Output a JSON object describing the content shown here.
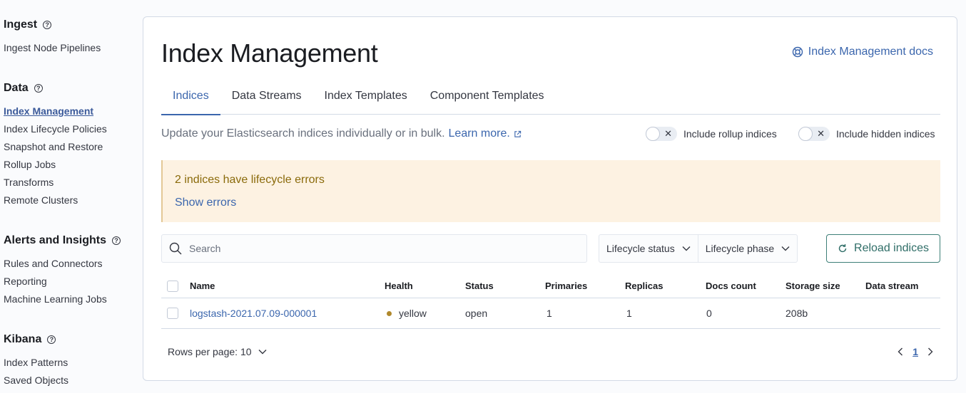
{
  "sidebar": {
    "groups": [
      {
        "title": "Ingest",
        "items": [
          "Ingest Node Pipelines"
        ]
      },
      {
        "title": "Data",
        "items": [
          "Index Management",
          "Index Lifecycle Policies",
          "Snapshot and Restore",
          "Rollup Jobs",
          "Transforms",
          "Remote Clusters"
        ]
      },
      {
        "title": "Alerts and Insights",
        "items": [
          "Rules and Connectors",
          "Reporting",
          "Machine Learning Jobs"
        ]
      },
      {
        "title": "Kibana",
        "items": [
          "Index Patterns",
          "Saved Objects"
        ]
      }
    ],
    "active_item": "Index Management"
  },
  "header": {
    "title": "Index Management",
    "docs_link": "Index Management docs"
  },
  "tabs": [
    {
      "label": "Indices",
      "active": true
    },
    {
      "label": "Data Streams",
      "active": false
    },
    {
      "label": "Index Templates",
      "active": false
    },
    {
      "label": "Component Templates",
      "active": false
    }
  ],
  "description": {
    "text": "Update your Elasticsearch indices individually or in bulk.",
    "link": "Learn more."
  },
  "toggles": {
    "rollup": {
      "label": "Include rollup indices",
      "on": false
    },
    "hidden": {
      "label": "Include hidden indices",
      "on": false
    }
  },
  "callout": {
    "title": "2 indices have lifecycle errors",
    "link": "Show errors"
  },
  "search": {
    "placeholder": "Search",
    "value": ""
  },
  "filters": {
    "lifecycle_status": "Lifecycle status",
    "lifecycle_phase": "Lifecycle phase"
  },
  "reload_button": "Reload indices",
  "table": {
    "columns": [
      "Name",
      "Health",
      "Status",
      "Primaries",
      "Replicas",
      "Docs count",
      "Storage size",
      "Data stream"
    ],
    "rows": [
      {
        "name": "logstash-2021.07.09-000001",
        "health": "yellow",
        "status": "open",
        "primaries": "1",
        "replicas": "1",
        "docs_count": "0",
        "storage_size": "208b",
        "data_stream": ""
      }
    ]
  },
  "pagination": {
    "rows_per_page": "Rows per page: 10",
    "current_page": "1"
  },
  "colors": {
    "link": "#3b66ad",
    "warning_bg": "#fdf2e2",
    "health_yellow": "#b0882c",
    "reload_border": "#3e7f78"
  }
}
